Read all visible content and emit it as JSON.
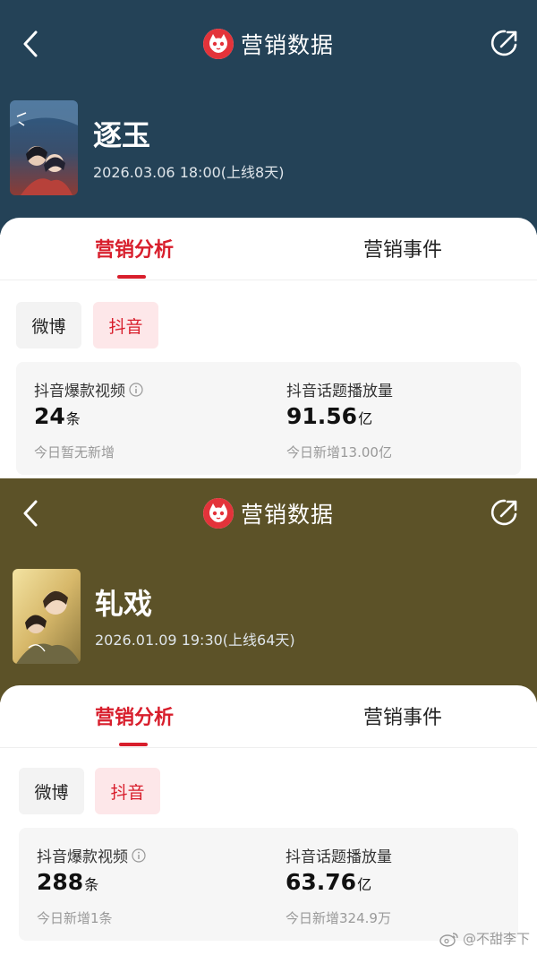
{
  "panels": [
    {
      "nav_title": "营销数据",
      "movie": {
        "title": "逐玉",
        "release": "2026.03.06 18:00(上线8天)"
      },
      "tabs": {
        "active": "营销分析",
        "inactive": "营销事件"
      },
      "chips": {
        "weibo": "微博",
        "douyin": "抖音"
      },
      "stats": [
        {
          "label": "抖音爆款视频",
          "value": "24",
          "unit": "条",
          "sub": "今日暂无新增"
        },
        {
          "label": "抖音话题播放量",
          "value": "91.56",
          "unit": "亿",
          "sub": "今日新增13.00亿"
        }
      ],
      "colors": {
        "header_bg": "#244257"
      }
    },
    {
      "nav_title": "营销数据",
      "movie": {
        "title": "轧戏",
        "release": "2026.01.09 19:30(上线64天)"
      },
      "tabs": {
        "active": "营销分析",
        "inactive": "营销事件"
      },
      "chips": {
        "weibo": "微博",
        "douyin": "抖音"
      },
      "stats": [
        {
          "label": "抖音爆款视频",
          "value": "288",
          "unit": "条",
          "sub": "今日新增1条"
        },
        {
          "label": "抖音话题播放量",
          "value": "63.76",
          "unit": "亿",
          "sub": "今日新增324.9万"
        }
      ],
      "colors": {
        "header_bg": "#5c5228"
      }
    }
  ],
  "watermark": {
    "text": "@不甜李下",
    "icon": "weibo-icon"
  },
  "colors": {
    "accent": "#d81e2c",
    "chip_active_bg": "#fde7e9"
  }
}
